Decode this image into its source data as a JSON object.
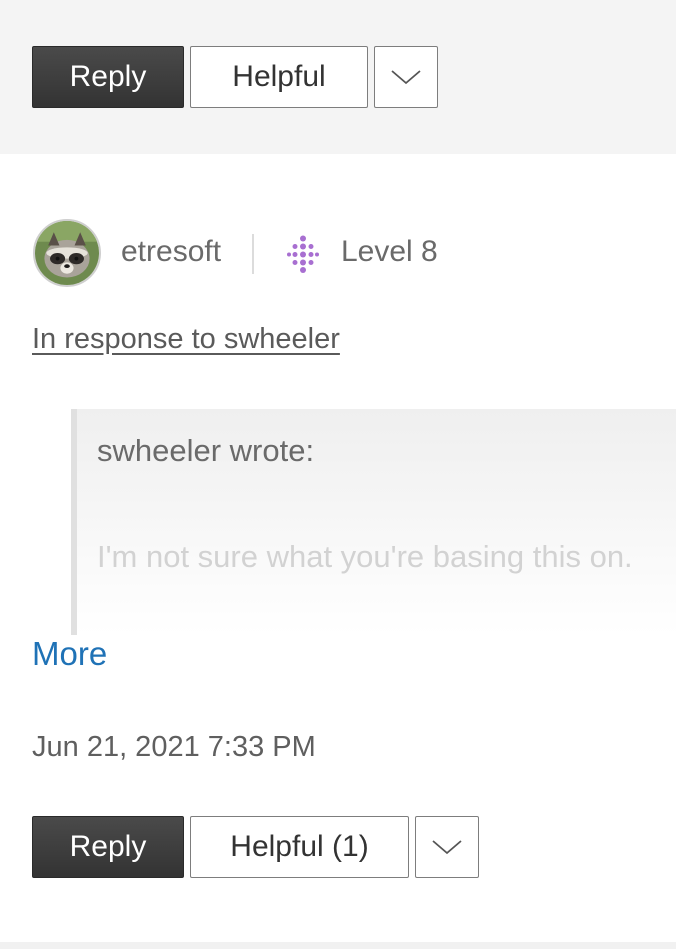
{
  "top_actions": {
    "reply_label": "Reply",
    "helpful_label": "Helpful",
    "more_options_icon": "chevron-down-icon"
  },
  "post": {
    "author": {
      "username": "etresoft",
      "avatar_icon": "raccoon-avatar",
      "rank_icon": "level-dots-icon",
      "rank_label": "Level 8",
      "rank_color": "#a86fd1"
    },
    "in_response_to": "In response to swheeler",
    "quote": {
      "author_line": "swheeler wrote:",
      "text": "I'm not sure what you're basing this on."
    },
    "more_label": "More",
    "timestamp": "Jun 21, 2021 7:33 PM"
  },
  "bottom_actions": {
    "reply_label": "Reply",
    "helpful_label": "Helpful (1)",
    "more_options_icon": "chevron-down-icon"
  },
  "colors": {
    "link_blue": "#1f72b6",
    "dark_button": "#3a3a3a"
  }
}
